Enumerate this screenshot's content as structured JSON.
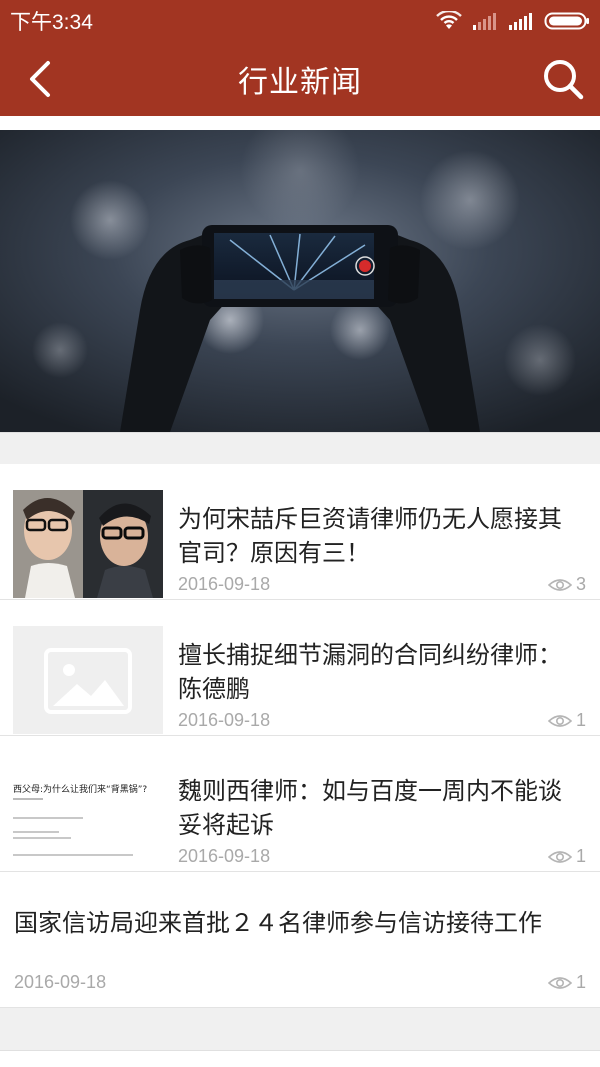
{
  "status_bar": {
    "time": "下午3:34"
  },
  "header": {
    "title": "行业新闻",
    "back_icon": "chevron-left-icon",
    "search_icon": "search-icon"
  },
  "banner": {
    "description_icon": "phone-recording-concert-image"
  },
  "news": [
    {
      "title": "为何宋喆斥巨资请律师仍无人愿接其官司？原因有三！",
      "date": "2016-09-18",
      "views": "3",
      "thumb": "portrait-photo"
    },
    {
      "title": "擅长捕捉细节漏洞的合同纠纷律师：陈德鹏",
      "date": "2016-09-18",
      "views": "1",
      "thumb": "image-placeholder-icon"
    },
    {
      "title": "魏则西律师：如与百度一周内不能谈妥将起诉",
      "date": "2016-09-18",
      "views": "1",
      "thumb": "article-text-snapshot",
      "thumb_heading": "西父母:为什么让我们来“背黑锅”?"
    },
    {
      "title": "国家信访局迎来首批２４名律师参与信访接待工作",
      "date": "2016-09-18",
      "views": "1",
      "thumb": ""
    }
  ],
  "colors": {
    "header_bg": "#a23522",
    "date_text": "#a9a9a9",
    "title_text": "#222222"
  }
}
